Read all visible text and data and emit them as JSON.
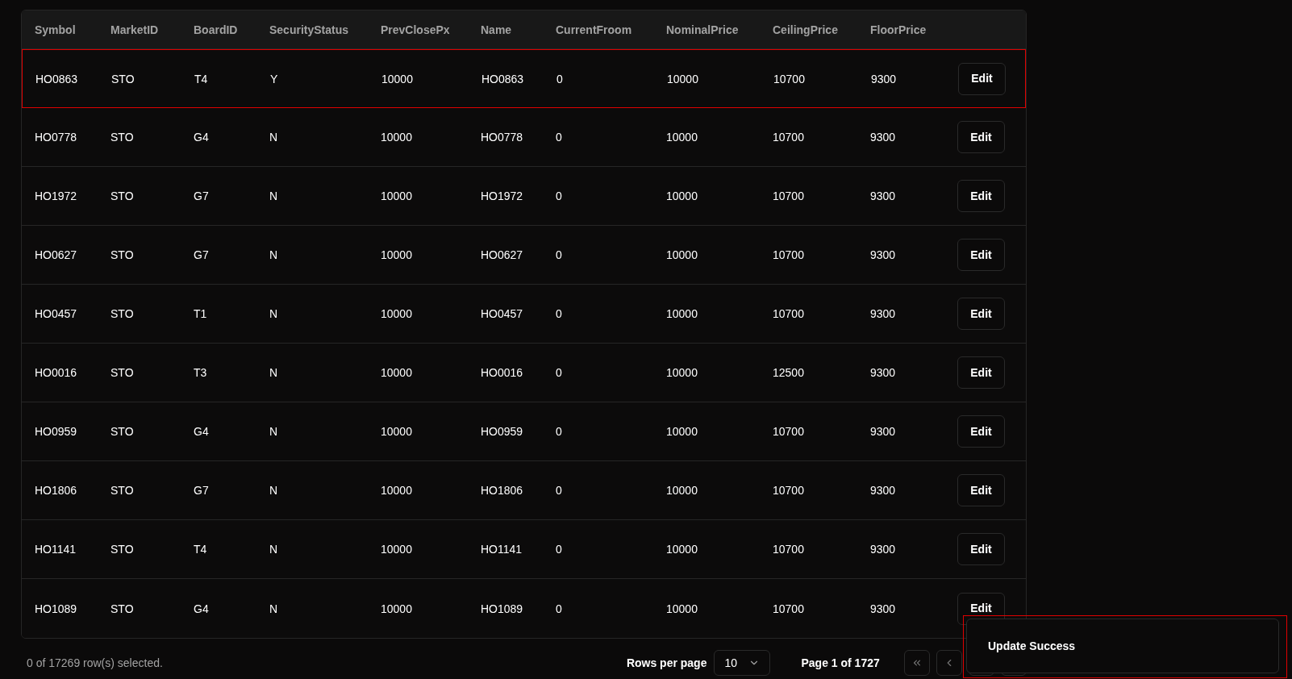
{
  "table": {
    "columns": [
      "Symbol",
      "MarketID",
      "BoardID",
      "SecurityStatus",
      "PrevClosePx",
      "Name",
      "CurrentFroom",
      "NominalPrice",
      "CeilingPrice",
      "FloorPrice"
    ],
    "rows": [
      {
        "cells": [
          "HO0863",
          "STO",
          "T4",
          "Y",
          "10000",
          "HO0863",
          "0",
          "10000",
          "10700",
          "9300"
        ],
        "action": "Edit",
        "highlighted": true
      },
      {
        "cells": [
          "HO0778",
          "STO",
          "G4",
          "N",
          "10000",
          "HO0778",
          "0",
          "10000",
          "10700",
          "9300"
        ],
        "action": "Edit",
        "highlighted": false
      },
      {
        "cells": [
          "HO1972",
          "STO",
          "G7",
          "N",
          "10000",
          "HO1972",
          "0",
          "10000",
          "10700",
          "9300"
        ],
        "action": "Edit",
        "highlighted": false
      },
      {
        "cells": [
          "HO0627",
          "STO",
          "G7",
          "N",
          "10000",
          "HO0627",
          "0",
          "10000",
          "10700",
          "9300"
        ],
        "action": "Edit",
        "highlighted": false
      },
      {
        "cells": [
          "HO0457",
          "STO",
          "T1",
          "N",
          "10000",
          "HO0457",
          "0",
          "10000",
          "10700",
          "9300"
        ],
        "action": "Edit",
        "highlighted": false
      },
      {
        "cells": [
          "HO0016",
          "STO",
          "T3",
          "N",
          "10000",
          "HO0016",
          "0",
          "10000",
          "12500",
          "9300"
        ],
        "action": "Edit",
        "highlighted": false
      },
      {
        "cells": [
          "HO0959",
          "STO",
          "G4",
          "N",
          "10000",
          "HO0959",
          "0",
          "10000",
          "10700",
          "9300"
        ],
        "action": "Edit",
        "highlighted": false
      },
      {
        "cells": [
          "HO1806",
          "STO",
          "G7",
          "N",
          "10000",
          "HO1806",
          "0",
          "10000",
          "10700",
          "9300"
        ],
        "action": "Edit",
        "highlighted": false
      },
      {
        "cells": [
          "HO1141",
          "STO",
          "T4",
          "N",
          "10000",
          "HO1141",
          "0",
          "10000",
          "10700",
          "9300"
        ],
        "action": "Edit",
        "highlighted": false
      },
      {
        "cells": [
          "HO1089",
          "STO",
          "G4",
          "N",
          "10000",
          "HO1089",
          "0",
          "10000",
          "10700",
          "9300"
        ],
        "action": "Edit",
        "highlighted": false
      }
    ]
  },
  "footer": {
    "selection": "0 of 17269 row(s) selected.",
    "rows_per_page_label": "Rows per page",
    "rows_per_page": "10",
    "page": "Page 1 of 1727"
  },
  "toast": {
    "message": "Update Success",
    "highlighted": true
  }
}
